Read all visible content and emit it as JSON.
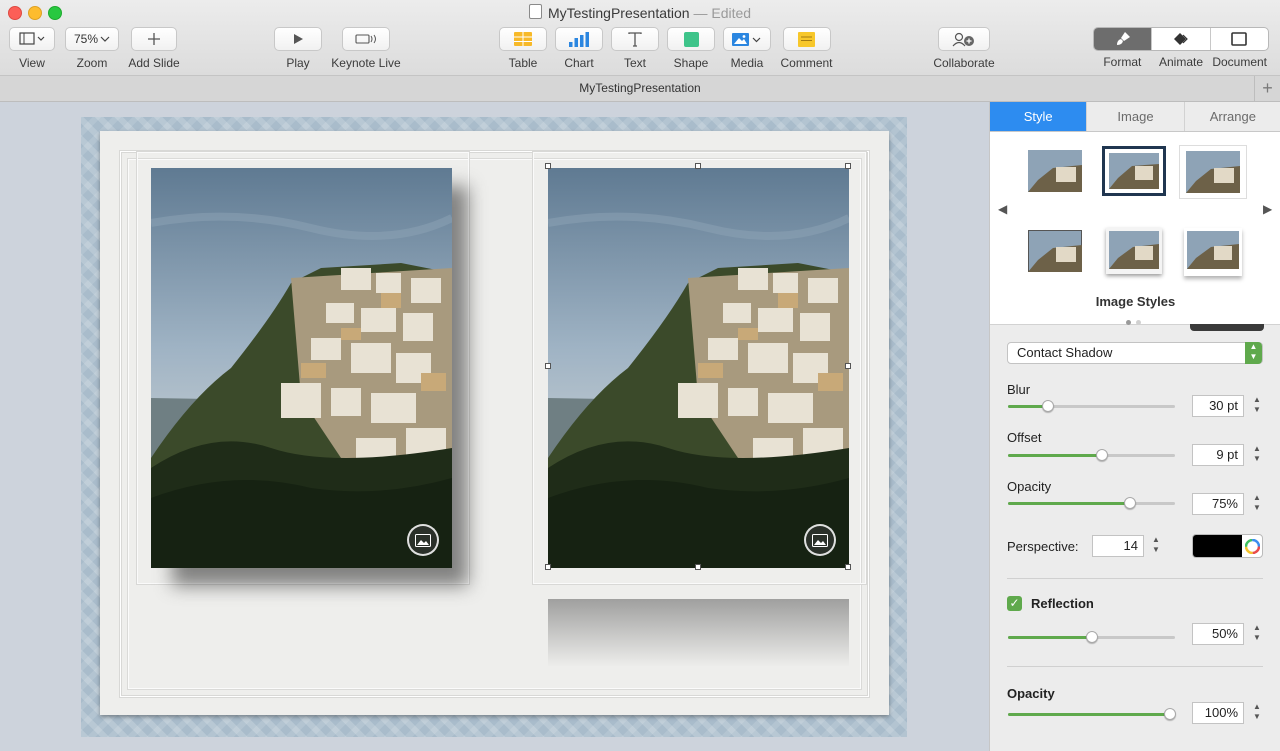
{
  "window": {
    "title": "MyTestingPresentation",
    "status": "— Edited"
  },
  "toolbar": {
    "view": "View",
    "zoom": "Zoom",
    "zoom_value": "75%",
    "add_slide": "Add Slide",
    "play": "Play",
    "keynote_live": "Keynote Live",
    "table": "Table",
    "chart": "Chart",
    "text": "Text",
    "shape": "Shape",
    "media": "Media",
    "comment": "Comment",
    "collaborate": "Collaborate",
    "format": "Format",
    "animate": "Animate",
    "document": "Document"
  },
  "tabbar": {
    "title": "MyTestingPresentation",
    "plus": "+"
  },
  "inspector": {
    "tabs": [
      "Style",
      "Image",
      "Arrange"
    ],
    "active_tab": "Style",
    "image_styles_title": "Image Styles",
    "shadow_type": "Contact Shadow",
    "blur_label": "Blur",
    "blur_value": "30 pt",
    "blur_fraction": 0.24,
    "offset_label": "Offset",
    "offset_value": "9 pt",
    "offset_fraction": 0.56,
    "opacity_label": "Opacity",
    "opacity_value": "75%",
    "opacity_fraction": 0.73,
    "perspective_label": "Perspective:",
    "perspective_value": "14",
    "shadow_color": "#000000",
    "reflection_label": "Reflection",
    "reflection_checked": true,
    "reflection_value": "50%",
    "reflection_fraction": 0.5,
    "image_opacity_label": "Opacity",
    "image_opacity_value": "100%",
    "image_opacity_fraction": 0.97
  },
  "colors": {
    "accent_blue": "#2d8cf0",
    "slider_green": "#5fa94c",
    "slide_border": "#a9bccb",
    "paper": "#eeeeec"
  }
}
